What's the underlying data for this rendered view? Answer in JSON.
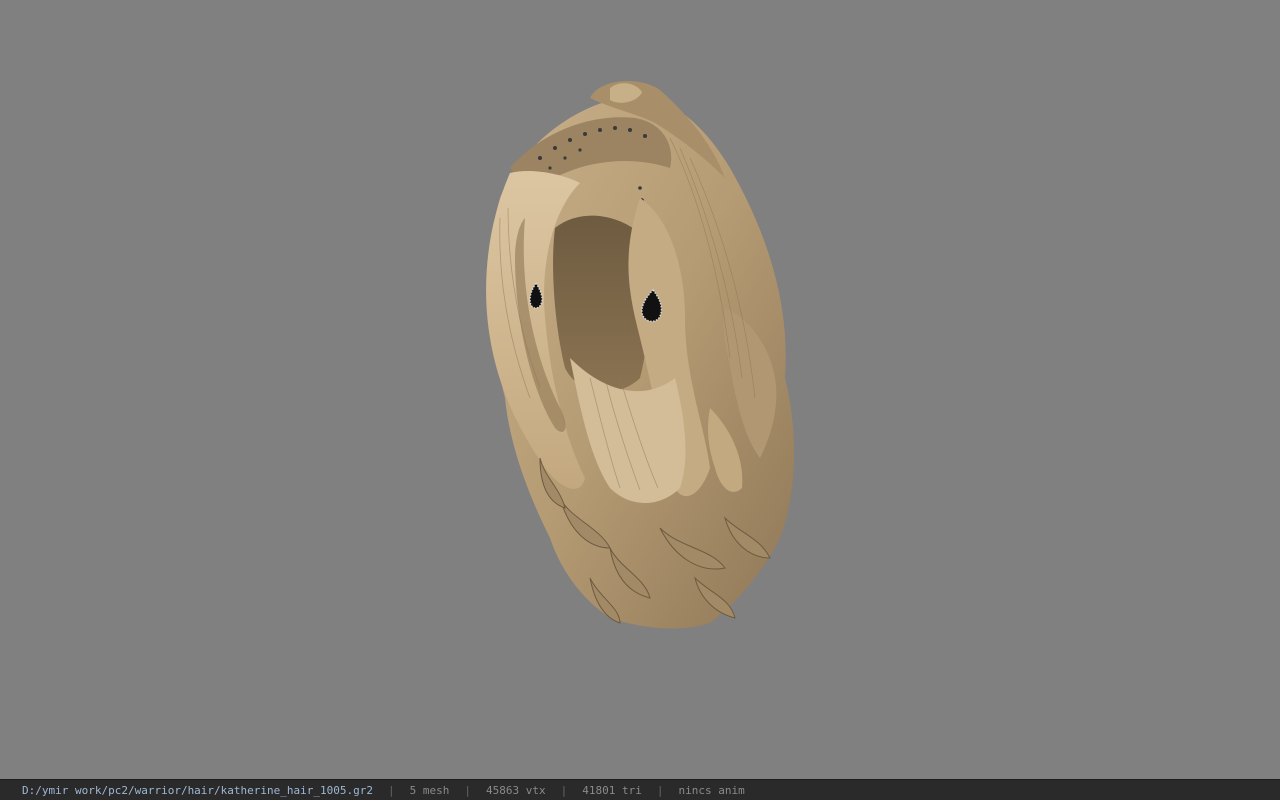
{
  "app": {
    "background_color": "#808080",
    "hair_color": "#b89f78"
  },
  "status_bar": {
    "file_path": "D:/ymir work/pc2/warrior/hair/katherine_hair_1005.gr2",
    "separator": "|",
    "mesh_count": "5 mesh",
    "vertex_count": "45863 vtx",
    "triangle_count": "41801 tri",
    "anim_status": "nincs anim"
  }
}
